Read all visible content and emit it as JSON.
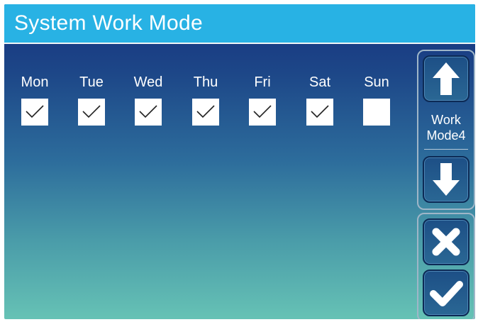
{
  "header": {
    "title": "System Work Mode"
  },
  "days": [
    {
      "label": "Mon",
      "checked": true
    },
    {
      "label": "Tue",
      "checked": true
    },
    {
      "label": "Wed",
      "checked": true
    },
    {
      "label": "Thu",
      "checked": true
    },
    {
      "label": "Fri",
      "checked": true
    },
    {
      "label": "Sat",
      "checked": true
    },
    {
      "label": "Sun",
      "checked": false
    }
  ],
  "side": {
    "mode_line1": "Work",
    "mode_line2": "Mode4",
    "up_icon": "arrow-up-icon",
    "down_icon": "arrow-down-icon",
    "cancel_icon": "close-icon",
    "confirm_icon": "check-icon"
  },
  "colors": {
    "title_bar": "#28b2e4",
    "gradient_top": "#16317e",
    "gradient_bottom": "#66c2b5",
    "button_fill": "#1d4f86"
  }
}
